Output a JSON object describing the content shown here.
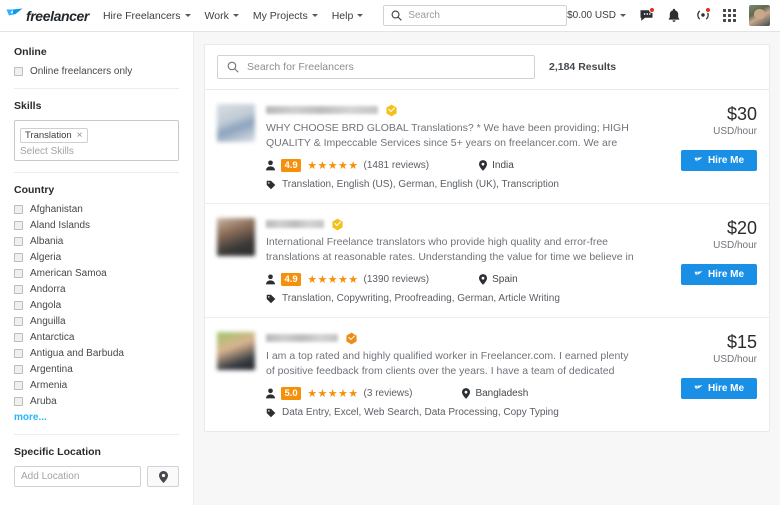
{
  "header": {
    "logo_text": "freelancer",
    "nav": [
      {
        "label": "Hire Freelancers"
      },
      {
        "label": "Work"
      },
      {
        "label": "My Projects"
      },
      {
        "label": "Help"
      }
    ],
    "search_placeholder": "Search",
    "balance": "$0.00 USD",
    "icons": {
      "chat": "chat-icon",
      "bell": "bell-icon",
      "broadcast": "broadcast-icon",
      "apps": "grid-apps-icon",
      "avatar": "user-avatar"
    }
  },
  "sidebar": {
    "online": {
      "title": "Online",
      "checkbox_label": "Online freelancers only",
      "checked": false
    },
    "skills": {
      "title": "Skills",
      "selected": [
        {
          "label": "Translation",
          "remove": "×"
        }
      ],
      "placeholder": "Select Skills"
    },
    "country": {
      "title": "Country",
      "items": [
        "Afghanistan",
        "Aland Islands",
        "Albania",
        "Algeria",
        "American Samoa",
        "Andorra",
        "Angola",
        "Anguilla",
        "Antarctica",
        "Antigua and Barbuda",
        "Argentina",
        "Armenia",
        "Aruba"
      ],
      "more_label": "more..."
    },
    "specific_location": {
      "title": "Specific Location",
      "placeholder": "Add Location",
      "button_icon": "map-pin-icon"
    }
  },
  "main": {
    "search_placeholder": "Search for Freelancers",
    "results_count": "2,184 Results",
    "results": [
      {
        "name_redacted": true,
        "verified_badge": "verified-badge-gold",
        "badge_color": "#f3c11a",
        "description": "WHY CHOOSE BRD GLOBAL Translations? * We have been providing; HIGH QUALITY & Impeccable Services since 5+ years on freelancer.com. We are THE BEST Translation &",
        "rating": "4.9",
        "stars": "★★★★★",
        "reviews": "(1481 reviews)",
        "location": "India",
        "tags": "Translation, English (US), German, English (UK), Transcription",
        "price": "$30",
        "price_unit": "USD/hour",
        "hire_label": "Hire Me"
      },
      {
        "name_redacted": true,
        "verified_badge": "verified-badge-gold",
        "badge_color": "#f3c11a",
        "description": "International Freelance translators who provide high quality and error-free translations at reasonable rates. Understanding the value for time we believe in completing projects before",
        "rating": "4.9",
        "stars": "★★★★★",
        "reviews": "(1390 reviews)",
        "location": "Spain",
        "tags": "Translation, Copywriting, Proofreading, German, Article Writing",
        "price": "$20",
        "price_unit": "USD/hour",
        "hire_label": "Hire Me"
      },
      {
        "name_redacted": true,
        "verified_badge": "verified-badge-orange",
        "badge_color": "#ef8b17",
        "description": "I am a top rated and highly qualified worker in Freelancer.com. I earned plenty of positive feedback from clients over the years. I have a team of dedicated professionals who are",
        "rating": "5.0",
        "stars": "★★★★★",
        "reviews": "(3 reviews)",
        "location": "Bangladesh",
        "tags": "Data Entry, Excel, Web Search, Data Processing, Copy Typing",
        "price": "$15",
        "price_unit": "USD/hour",
        "hire_label": "Hire Me"
      }
    ]
  },
  "colors": {
    "brand_blue": "#1990e5",
    "logo_blue": "#29b2fe",
    "rating_orange": "#f5900b",
    "link_blue": "#29b2fe",
    "badge_red": "#e0301e"
  }
}
